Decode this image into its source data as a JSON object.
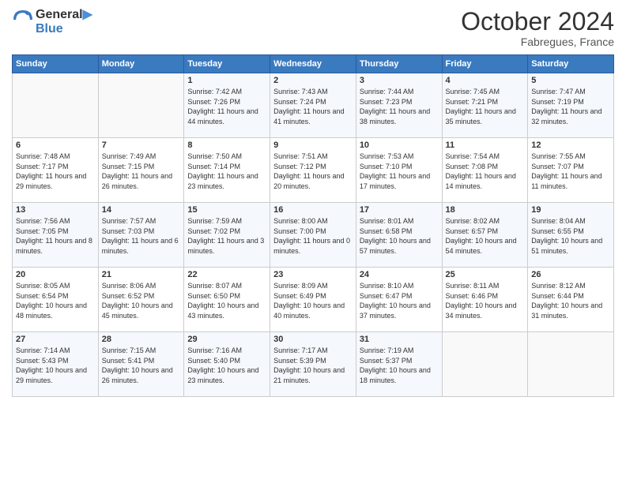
{
  "logo": {
    "line1": "General",
    "line2": "Blue"
  },
  "title": "October 2024",
  "location": "Fabregues, France",
  "header": {
    "days": [
      "Sunday",
      "Monday",
      "Tuesday",
      "Wednesday",
      "Thursday",
      "Friday",
      "Saturday"
    ]
  },
  "weeks": [
    [
      {
        "day": "",
        "sunrise": "",
        "sunset": "",
        "daylight": ""
      },
      {
        "day": "",
        "sunrise": "",
        "sunset": "",
        "daylight": ""
      },
      {
        "day": "1",
        "sunrise": "Sunrise: 7:42 AM",
        "sunset": "Sunset: 7:26 PM",
        "daylight": "Daylight: 11 hours and 44 minutes."
      },
      {
        "day": "2",
        "sunrise": "Sunrise: 7:43 AM",
        "sunset": "Sunset: 7:24 PM",
        "daylight": "Daylight: 11 hours and 41 minutes."
      },
      {
        "day": "3",
        "sunrise": "Sunrise: 7:44 AM",
        "sunset": "Sunset: 7:23 PM",
        "daylight": "Daylight: 11 hours and 38 minutes."
      },
      {
        "day": "4",
        "sunrise": "Sunrise: 7:45 AM",
        "sunset": "Sunset: 7:21 PM",
        "daylight": "Daylight: 11 hours and 35 minutes."
      },
      {
        "day": "5",
        "sunrise": "Sunrise: 7:47 AM",
        "sunset": "Sunset: 7:19 PM",
        "daylight": "Daylight: 11 hours and 32 minutes."
      }
    ],
    [
      {
        "day": "6",
        "sunrise": "Sunrise: 7:48 AM",
        "sunset": "Sunset: 7:17 PM",
        "daylight": "Daylight: 11 hours and 29 minutes."
      },
      {
        "day": "7",
        "sunrise": "Sunrise: 7:49 AM",
        "sunset": "Sunset: 7:15 PM",
        "daylight": "Daylight: 11 hours and 26 minutes."
      },
      {
        "day": "8",
        "sunrise": "Sunrise: 7:50 AM",
        "sunset": "Sunset: 7:14 PM",
        "daylight": "Daylight: 11 hours and 23 minutes."
      },
      {
        "day": "9",
        "sunrise": "Sunrise: 7:51 AM",
        "sunset": "Sunset: 7:12 PM",
        "daylight": "Daylight: 11 hours and 20 minutes."
      },
      {
        "day": "10",
        "sunrise": "Sunrise: 7:53 AM",
        "sunset": "Sunset: 7:10 PM",
        "daylight": "Daylight: 11 hours and 17 minutes."
      },
      {
        "day": "11",
        "sunrise": "Sunrise: 7:54 AM",
        "sunset": "Sunset: 7:08 PM",
        "daylight": "Daylight: 11 hours and 14 minutes."
      },
      {
        "day": "12",
        "sunrise": "Sunrise: 7:55 AM",
        "sunset": "Sunset: 7:07 PM",
        "daylight": "Daylight: 11 hours and 11 minutes."
      }
    ],
    [
      {
        "day": "13",
        "sunrise": "Sunrise: 7:56 AM",
        "sunset": "Sunset: 7:05 PM",
        "daylight": "Daylight: 11 hours and 8 minutes."
      },
      {
        "day": "14",
        "sunrise": "Sunrise: 7:57 AM",
        "sunset": "Sunset: 7:03 PM",
        "daylight": "Daylight: 11 hours and 6 minutes."
      },
      {
        "day": "15",
        "sunrise": "Sunrise: 7:59 AM",
        "sunset": "Sunset: 7:02 PM",
        "daylight": "Daylight: 11 hours and 3 minutes."
      },
      {
        "day": "16",
        "sunrise": "Sunrise: 8:00 AM",
        "sunset": "Sunset: 7:00 PM",
        "daylight": "Daylight: 11 hours and 0 minutes."
      },
      {
        "day": "17",
        "sunrise": "Sunrise: 8:01 AM",
        "sunset": "Sunset: 6:58 PM",
        "daylight": "Daylight: 10 hours and 57 minutes."
      },
      {
        "day": "18",
        "sunrise": "Sunrise: 8:02 AM",
        "sunset": "Sunset: 6:57 PM",
        "daylight": "Daylight: 10 hours and 54 minutes."
      },
      {
        "day": "19",
        "sunrise": "Sunrise: 8:04 AM",
        "sunset": "Sunset: 6:55 PM",
        "daylight": "Daylight: 10 hours and 51 minutes."
      }
    ],
    [
      {
        "day": "20",
        "sunrise": "Sunrise: 8:05 AM",
        "sunset": "Sunset: 6:54 PM",
        "daylight": "Daylight: 10 hours and 48 minutes."
      },
      {
        "day": "21",
        "sunrise": "Sunrise: 8:06 AM",
        "sunset": "Sunset: 6:52 PM",
        "daylight": "Daylight: 10 hours and 45 minutes."
      },
      {
        "day": "22",
        "sunrise": "Sunrise: 8:07 AM",
        "sunset": "Sunset: 6:50 PM",
        "daylight": "Daylight: 10 hours and 43 minutes."
      },
      {
        "day": "23",
        "sunrise": "Sunrise: 8:09 AM",
        "sunset": "Sunset: 6:49 PM",
        "daylight": "Daylight: 10 hours and 40 minutes."
      },
      {
        "day": "24",
        "sunrise": "Sunrise: 8:10 AM",
        "sunset": "Sunset: 6:47 PM",
        "daylight": "Daylight: 10 hours and 37 minutes."
      },
      {
        "day": "25",
        "sunrise": "Sunrise: 8:11 AM",
        "sunset": "Sunset: 6:46 PM",
        "daylight": "Daylight: 10 hours and 34 minutes."
      },
      {
        "day": "26",
        "sunrise": "Sunrise: 8:12 AM",
        "sunset": "Sunset: 6:44 PM",
        "daylight": "Daylight: 10 hours and 31 minutes."
      }
    ],
    [
      {
        "day": "27",
        "sunrise": "Sunrise: 7:14 AM",
        "sunset": "Sunset: 5:43 PM",
        "daylight": "Daylight: 10 hours and 29 minutes."
      },
      {
        "day": "28",
        "sunrise": "Sunrise: 7:15 AM",
        "sunset": "Sunset: 5:41 PM",
        "daylight": "Daylight: 10 hours and 26 minutes."
      },
      {
        "day": "29",
        "sunrise": "Sunrise: 7:16 AM",
        "sunset": "Sunset: 5:40 PM",
        "daylight": "Daylight: 10 hours and 23 minutes."
      },
      {
        "day": "30",
        "sunrise": "Sunrise: 7:17 AM",
        "sunset": "Sunset: 5:39 PM",
        "daylight": "Daylight: 10 hours and 21 minutes."
      },
      {
        "day": "31",
        "sunrise": "Sunrise: 7:19 AM",
        "sunset": "Sunset: 5:37 PM",
        "daylight": "Daylight: 10 hours and 18 minutes."
      },
      {
        "day": "",
        "sunrise": "",
        "sunset": "",
        "daylight": ""
      },
      {
        "day": "",
        "sunrise": "",
        "sunset": "",
        "daylight": ""
      }
    ]
  ]
}
